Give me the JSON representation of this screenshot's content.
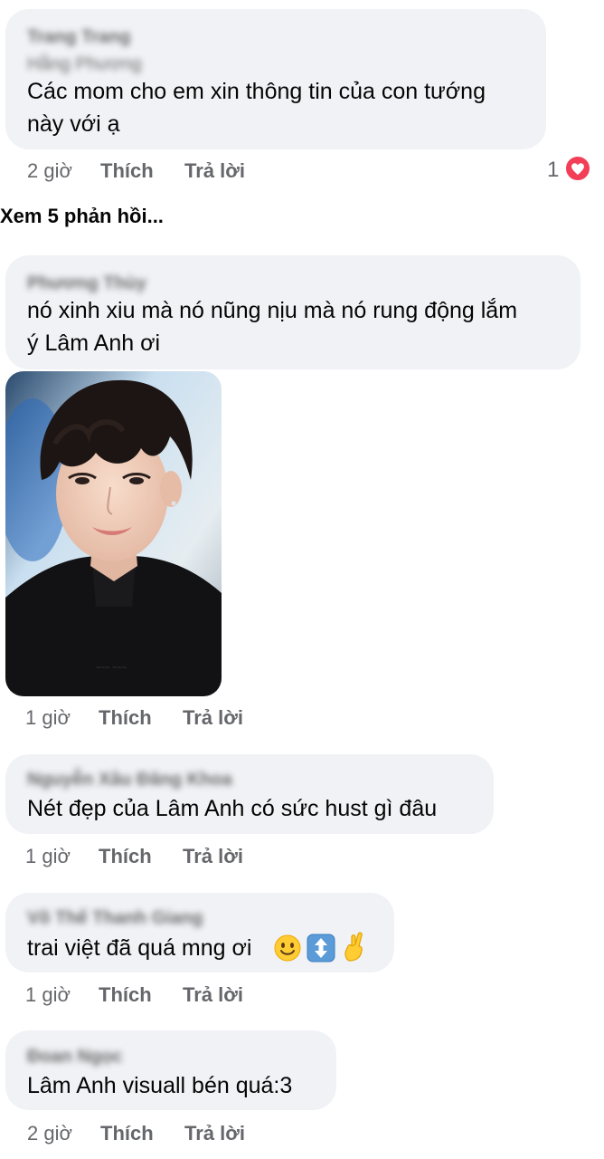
{
  "comments": [
    {
      "author": "Trang Trang",
      "author_line2": "Hằng Phương",
      "text_lines": [
        "Các mom cho em xin thông tin của con tướng",
        "này với ạ"
      ],
      "time": "2 giờ",
      "like": "Thích",
      "reply": "Trả lời",
      "reaction_count": "1",
      "reaction_icon": "heart-icon"
    },
    {
      "author": "Phương Thùy",
      "text_lines": [
        "nó xinh xiu mà nó nũng nịu mà nó rung động lắm",
        "ý Lâm Anh ơi"
      ],
      "time": "1 giờ",
      "like": "Thích",
      "reply": "Trả lời"
    },
    {
      "author": "Nguyễn Xâu Đăng Khoa",
      "text_lines": [
        "Nét đẹp của Lâm Anh có sức hust gì đâu"
      ],
      "time": "1 giờ",
      "like": "Thích",
      "reply": "Trả lời"
    },
    {
      "author": "Võ Thế Thanh Giang",
      "text_lines": [
        "trai việt đã quá mng ơi"
      ],
      "emojis": [
        "smiling-face-icon",
        "up-down-arrow-icon",
        "crossed-fingers-icon"
      ],
      "time": "1 giờ",
      "like": "Thích",
      "reply": "Trả lời"
    },
    {
      "author": "Đoan Ngọc",
      "text_lines": [
        "Lâm Anh visuall bén quá:3"
      ],
      "time": "2 giờ",
      "like": "Thích",
      "reply": "Trả lời"
    }
  ],
  "view_replies": "Xem 5 phản hồi...",
  "colors": {
    "bubble": "#f0f2f5",
    "meta": "#65676b",
    "heart": "#f33e58"
  }
}
